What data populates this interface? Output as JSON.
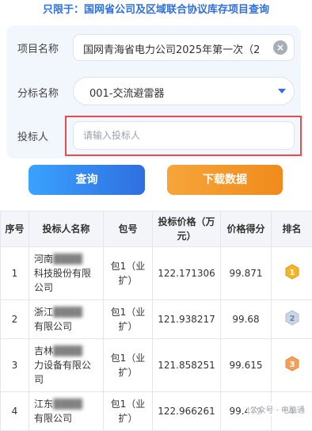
{
  "notice": "只限于：国网省公司及区域联合协议库存项目查询",
  "form": {
    "project_label": "项目名称",
    "project_value": "国网青海省电力公司2025年第一次（2",
    "lot_label": "分标名称",
    "lot_value": "001-交流避雷器",
    "bidder_label": "投标人",
    "bidder_placeholder": "请输入投标人"
  },
  "buttons": {
    "query": "查询",
    "download": "下载数据"
  },
  "table": {
    "headers": [
      "序号",
      "投标人名称",
      "包号",
      "投标价格（万元）",
      "价格得分",
      "排名"
    ],
    "rows": [
      {
        "no": "1",
        "name_a": "河南",
        "name_b": "科技股份有限",
        "name_c": "公司",
        "pkg_a": "包1（业",
        "pkg_b": "扩）",
        "price": "122.171306",
        "score": "99.871",
        "rank": "1"
      },
      {
        "no": "2",
        "name_a": "浙江",
        "name_b": "有限公司",
        "name_c": "",
        "pkg_a": "包1（业",
        "pkg_b": "扩）",
        "price": "121.938217",
        "score": "99.68",
        "rank": "2"
      },
      {
        "no": "3",
        "name_a": "吉林",
        "name_b": "力设备有限公",
        "name_c": "司",
        "pkg_a": "包1（业",
        "pkg_b": "扩）",
        "price": "121.858251",
        "score": "99.615",
        "rank": "3"
      },
      {
        "no": "4",
        "name_a": "江东",
        "name_b": "有限公司",
        "name_c": "",
        "pkg_a": "包1（业",
        "pkg_b": "扩）",
        "price": "122.966261",
        "score": "99.479",
        "rank": "4"
      }
    ]
  },
  "watermark": "公众号 · 电脑通",
  "colors": {
    "accent": "#2f6fe0",
    "highlight": "#e84c4c",
    "gold": "#f5b326",
    "silver": "#a9bdd4",
    "bronze": "#e98a3a"
  }
}
